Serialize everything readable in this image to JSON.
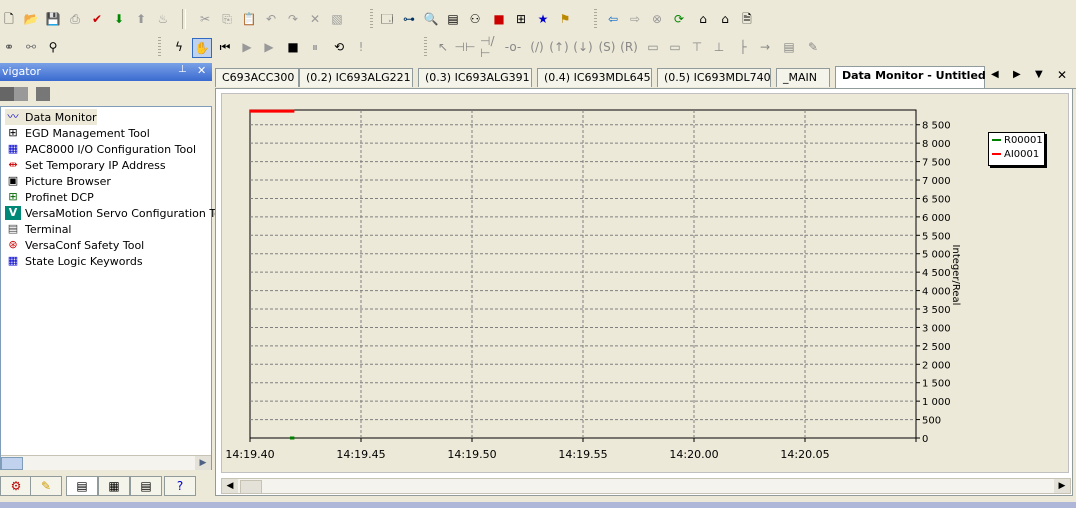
{
  "navigator": {
    "title": "vigator",
    "pin_glyph": "⊥",
    "close_glyph": "✕",
    "items": [
      {
        "label": "Data Monitor",
        "icon": "data-monitor-icon",
        "glyph": "〰"
      },
      {
        "label": "EGD Management Tool",
        "icon": "egd-icon",
        "glyph": "⊞"
      },
      {
        "label": "PAC8000 I/O Configuration Tool",
        "icon": "io-config-icon",
        "glyph": "▦"
      },
      {
        "label": "Set Temporary IP Address",
        "icon": "ip-address-icon",
        "glyph": "⇹"
      },
      {
        "label": "Picture Browser",
        "icon": "picture-browser-icon",
        "glyph": "▣"
      },
      {
        "label": "Profinet DCP",
        "icon": "profinet-icon",
        "glyph": "⊞"
      },
      {
        "label": "VersaMotion Servo Configuration Tool",
        "icon": "versamotion-icon",
        "glyph": "V"
      },
      {
        "label": "Terminal",
        "icon": "terminal-icon",
        "glyph": "▤"
      },
      {
        "label": "VersaConf Safety Tool",
        "icon": "safety-tool-icon",
        "glyph": "⊛"
      },
      {
        "label": "State Logic Keywords",
        "icon": "keywords-icon",
        "glyph": "▦"
      }
    ]
  },
  "tabs": [
    {
      "label": "C693ACC300"
    },
    {
      "label": "(0.2) IC693ALG221"
    },
    {
      "label": "(0.3) IC693ALG391"
    },
    {
      "label": "(0.4) IC693MDL645"
    },
    {
      "label": "(0.5) IC693MDL740"
    },
    {
      "label": "_MAIN"
    },
    {
      "label": "Data Monitor - Untitled"
    }
  ],
  "tab_controls": {
    "prev": "◀",
    "next": "▶",
    "menu": "▼",
    "close": "✕"
  },
  "scroll": {
    "left": "◀",
    "right": "▶",
    "nav_right": "▶"
  },
  "colors": {
    "R00001": "#008000",
    "AI0001": "#ff0000"
  },
  "chart_data": {
    "type": "line",
    "x": [
      "14:19.40",
      "14:19.45",
      "14:19.50",
      "14:19.55",
      "14:20.00",
      "14:20.05"
    ],
    "ylabel": "Integer/Real",
    "ylim": [
      0,
      8900
    ],
    "y_ticks": [
      "0",
      "500",
      "1 000",
      "1 500",
      "2 000",
      "2 500",
      "3 000",
      "3 500",
      "4 000",
      "4 500",
      "5 000",
      "5 500",
      "6 000",
      "6 500",
      "7 000",
      "7 500",
      "8 000",
      "8 500"
    ],
    "grid": true,
    "legend_position": "top-right",
    "series": [
      {
        "name": "R00001",
        "color": "#008000",
        "x_range_seconds": [
          1.8,
          2.0
        ],
        "value": 0
      },
      {
        "name": "AI0001",
        "color": "#ff0000",
        "x_range_seconds": [
          0.0,
          2.0
        ],
        "value": 8870
      }
    ]
  }
}
